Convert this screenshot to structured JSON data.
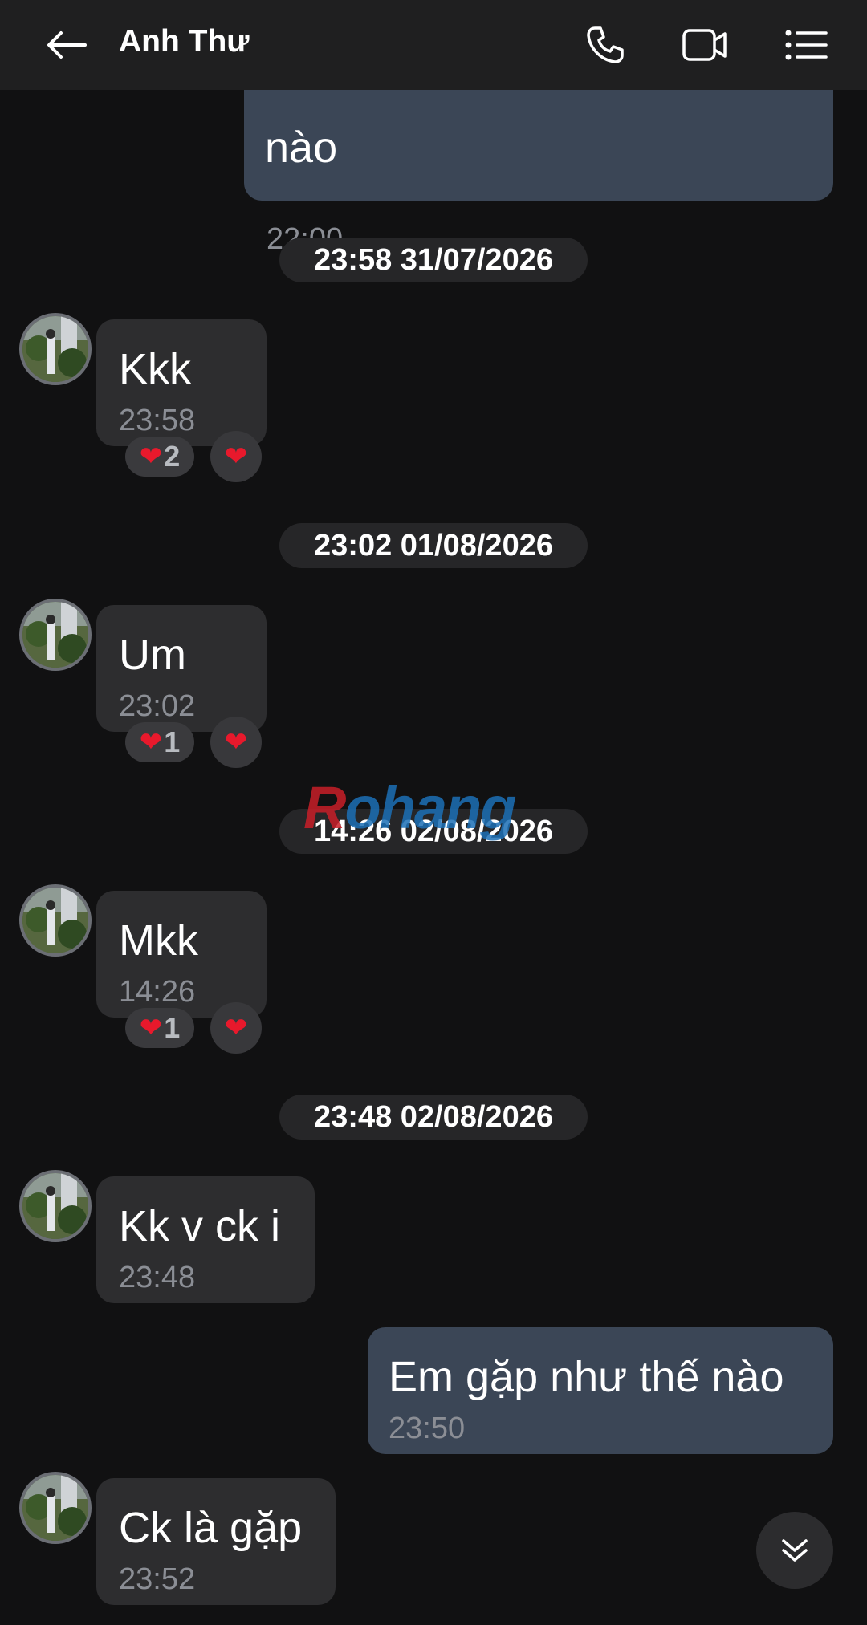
{
  "header": {
    "contact_name": "Anh Thư",
    "back_icon": "arrow-left-icon",
    "call_icon": "phone-icon",
    "video_icon": "video-camera-icon",
    "menu_icon": "list-menu-icon"
  },
  "messages": [
    {
      "direction": "out",
      "text": "nào",
      "time": "22:00"
    },
    {
      "type": "date",
      "label": "23:58 31/07/2026"
    },
    {
      "direction": "in",
      "text": "Kkk",
      "time": "23:58",
      "reaction_count": "2"
    },
    {
      "type": "date",
      "label": "23:02 01/08/2026"
    },
    {
      "direction": "in",
      "text": "Um",
      "time": "23:02",
      "reaction_count": "1"
    },
    {
      "type": "date",
      "label": "14:26 02/08/2026"
    },
    {
      "direction": "in",
      "text": "Mkk",
      "time": "14:26",
      "reaction_count": "1"
    },
    {
      "type": "date",
      "label": "23:48 02/08/2026"
    },
    {
      "direction": "in",
      "text": "Kk v ck i",
      "time": "23:48"
    },
    {
      "direction": "out",
      "text": "Em gặp như thế nào",
      "time": "23:50"
    },
    {
      "direction": "in",
      "text": "Ck là gặp",
      "time": "23:52"
    }
  ],
  "watermark": {
    "first": "R",
    "rest": "ohang"
  },
  "reaction_emoji": "❤",
  "colors": {
    "background": "#111112",
    "header": "#1f1f20",
    "incoming_bubble": "#2d2d2f",
    "outgoing_bubble": "#3b4656",
    "heart": "#e8192c"
  }
}
